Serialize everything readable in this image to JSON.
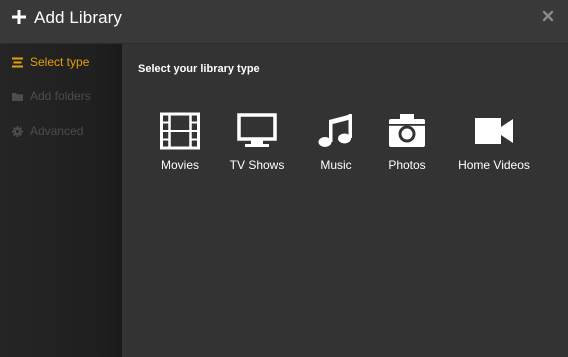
{
  "header": {
    "title": "Add Library",
    "icon": "plus-icon",
    "close_icon": "close-icon"
  },
  "sidebar": {
    "items": [
      {
        "label": "Select type",
        "icon": "list-icon",
        "state": "active"
      },
      {
        "label": "Add folders",
        "icon": "folder-icon",
        "state": "disabled"
      },
      {
        "label": "Advanced",
        "icon": "gear-icon",
        "state": "disabled"
      }
    ]
  },
  "main": {
    "heading": "Select your library type",
    "library_types": [
      {
        "label": "Movies",
        "icon": "film-icon"
      },
      {
        "label": "TV Shows",
        "icon": "tv-icon"
      },
      {
        "label": "Music",
        "icon": "music-note-icon"
      },
      {
        "label": "Photos",
        "icon": "camera-icon"
      },
      {
        "label": "Home Videos",
        "icon": "video-camera-icon"
      }
    ]
  },
  "colors": {
    "accent": "#e5a00d",
    "background": "#333333",
    "header": "#393939",
    "sidebar": "#1f1f1f",
    "disabled_text": "#4d4d4d"
  }
}
